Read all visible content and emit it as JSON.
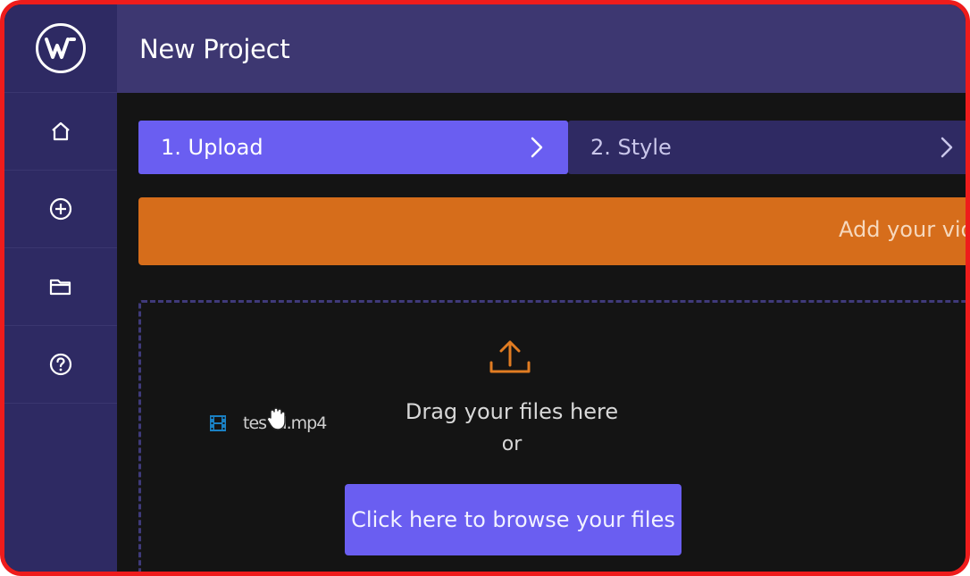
{
  "header": {
    "title": "New Project"
  },
  "sidebar": {
    "logo": "wevideo-logo-icon",
    "items": [
      {
        "icon": "home-icon"
      },
      {
        "icon": "plus-circle-icon"
      },
      {
        "icon": "folder-icon"
      },
      {
        "icon": "help-icon"
      }
    ]
  },
  "steps": [
    {
      "label": "1. Upload",
      "active": true
    },
    {
      "label": "2. Style",
      "active": false
    }
  ],
  "banner": {
    "text": "Add your vid"
  },
  "dropzone": {
    "drag_text": "Drag your files here",
    "or_text": "or",
    "browse_label": "Click here to browse your files",
    "dragged_file": "tes  td.mp4"
  },
  "colors": {
    "accent": "#6a5ef1",
    "sidebar": "#2e2a63",
    "header": "#3d3771",
    "banner": "#d66d1b",
    "frame": "#ee1c1c"
  }
}
